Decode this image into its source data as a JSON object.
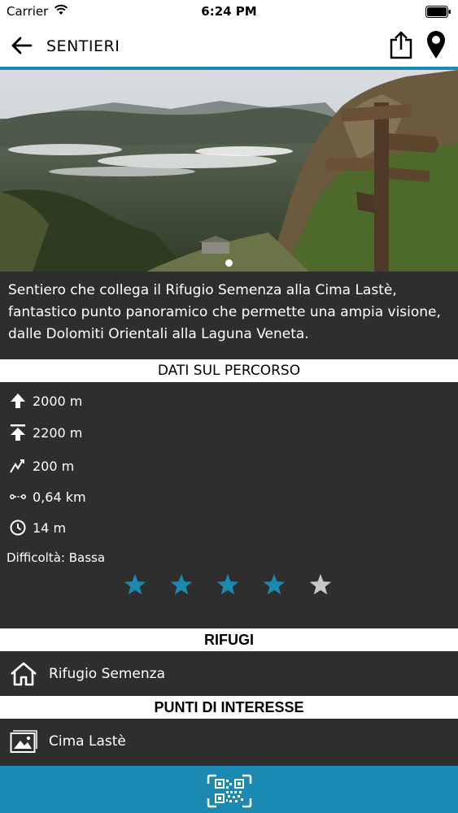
{
  "status_bar": {
    "carrier": "Carrier",
    "time": "6:24 PM"
  },
  "nav": {
    "title": "SENTIERI"
  },
  "hero": {
    "slide_count": 1,
    "active_slide": 1
  },
  "description": "Sentiero che collega il Rifugio Semenza alla Cima Lastè, fantastico punto panoramico che permette una ampia visione, dalle Dolomiti Orientali alla Laguna Veneta.",
  "route": {
    "header": "DATI SUL PERCORSO",
    "start_altitude": "2000 m",
    "max_altitude": "2200 m",
    "elevation_gain": "200 m",
    "length": "0,64 km",
    "duration": "14 m",
    "difficulty_label": "Difficoltà:",
    "difficulty_value": "Bassa",
    "rating": 4,
    "rating_max": 5
  },
  "rifugi": {
    "header": "RIFUGI",
    "items": [
      {
        "label": "Rifugio Semenza"
      }
    ]
  },
  "poi": {
    "header": "PUNTI DI INTERESSE",
    "items": [
      {
        "label": "Cima Lastè"
      }
    ]
  },
  "colors": {
    "accent": "#1b8ab3",
    "star_active": "#1b8ab3",
    "star_inactive": "#c8c8c8",
    "background": "#2e2e2e"
  }
}
